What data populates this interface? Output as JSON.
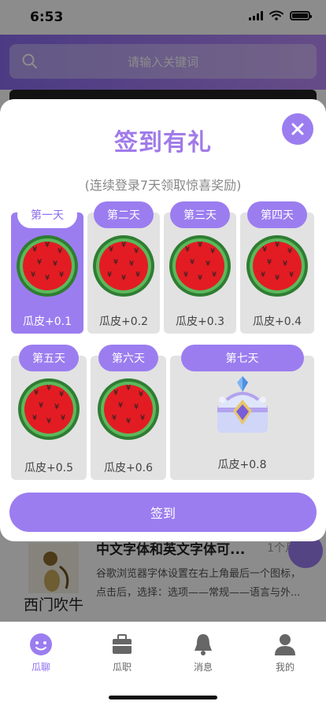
{
  "status_bar": {
    "time": "6:53"
  },
  "search": {
    "placeholder": "请输入关键词"
  },
  "article": {
    "author": "西门吹牛",
    "title": "中文字体和英文字体可...",
    "time": "1个月前",
    "desc": "谷歌浏览器字体设置在右上角最后一个图标，点击后，选择：选项——常规——语言与外..."
  },
  "modal": {
    "title": "签到有礼",
    "subtitle": "(连续登录7天领取惊喜奖励)",
    "days": [
      {
        "label": "第一天",
        "reward": "瓜皮+0.1",
        "signed": true,
        "icon": "watermelon-icon"
      },
      {
        "label": "第二天",
        "reward": "瓜皮+0.2",
        "signed": false,
        "icon": "watermelon-icon"
      },
      {
        "label": "第三天",
        "reward": "瓜皮+0.3",
        "signed": false,
        "icon": "watermelon-icon"
      },
      {
        "label": "第四天",
        "reward": "瓜皮+0.4",
        "signed": false,
        "icon": "watermelon-icon"
      },
      {
        "label": "第五天",
        "reward": "瓜皮+0.5",
        "signed": false,
        "icon": "watermelon-icon"
      },
      {
        "label": "第六天",
        "reward": "瓜皮+0.6",
        "signed": false,
        "icon": "watermelon-icon"
      },
      {
        "label": "第七天",
        "reward": "瓜皮+0.8",
        "signed": false,
        "icon": "treasure-chest-icon"
      }
    ],
    "sign_button": "签到"
  },
  "tabbar": {
    "items": [
      {
        "label": "瓜聊",
        "icon": "chat-bubble-icon",
        "active": true
      },
      {
        "label": "瓜职",
        "icon": "briefcase-icon",
        "active": false
      },
      {
        "label": "消息",
        "icon": "bell-icon",
        "active": false
      },
      {
        "label": "我的",
        "icon": "user-icon",
        "active": false
      }
    ]
  },
  "colors": {
    "accent": "#9b7df0",
    "title": "#a07be8",
    "tile": "#e2e2e2"
  }
}
